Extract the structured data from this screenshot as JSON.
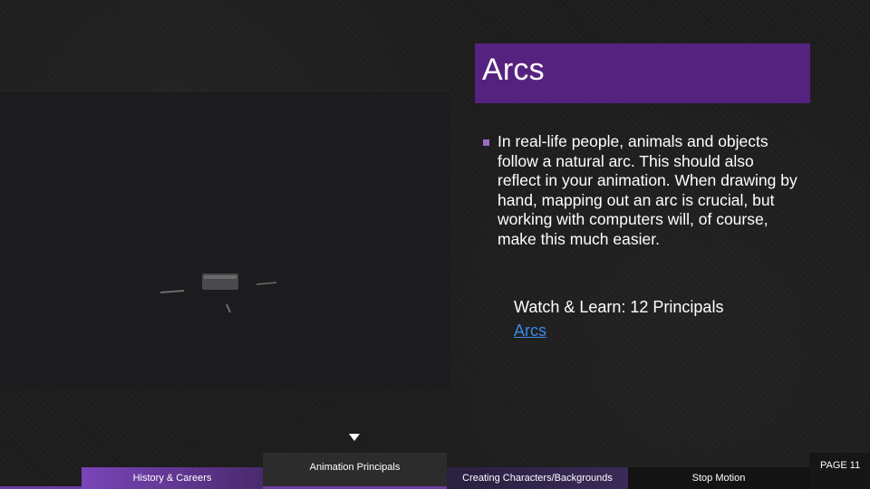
{
  "slide": {
    "title": "Arcs",
    "bullet": "In real-life people, animals and objects follow a natural arc. This should also reflect in your animation. When drawing by hand, mapping out an arc is crucial, but working with computers will, of course, make this much easier.",
    "watch_label": "Watch & Learn: 12 Principals",
    "link_label": "Arcs"
  },
  "nav": {
    "items": [
      {
        "label": "History & Careers"
      },
      {
        "label": "Animation Principals"
      },
      {
        "label": "Creating Characters/Backgrounds"
      },
      {
        "label": "Stop Motion"
      }
    ],
    "page_label": "PAGE 11"
  },
  "colors": {
    "title_bg": "#55237f",
    "link": "#3e89e6",
    "accent": "#7a45b8"
  }
}
